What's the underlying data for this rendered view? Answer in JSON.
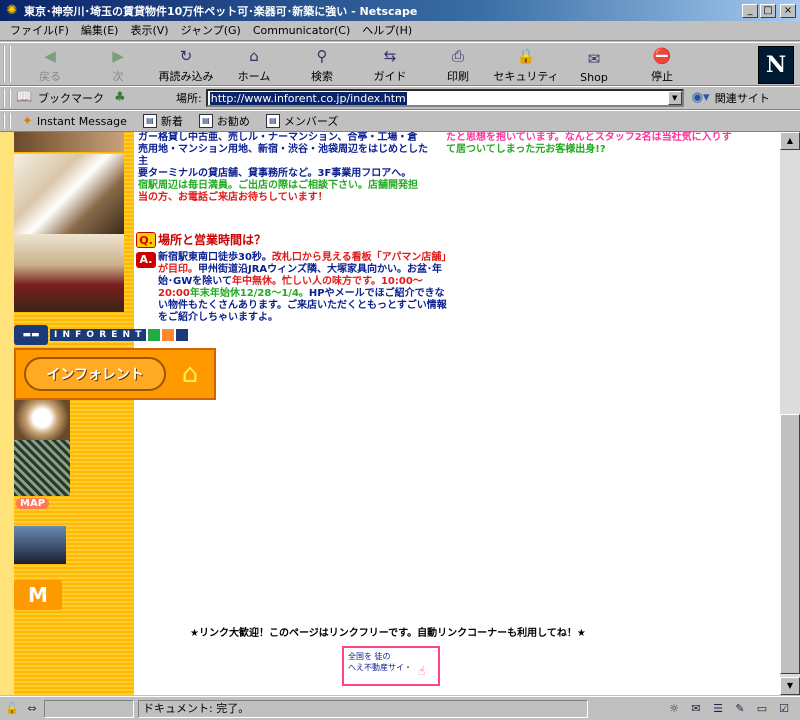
{
  "window": {
    "title": "東京･神奈川･埼玉の賃貸物件10万件ペット可･楽器可･新築に強い - Netscape",
    "controls": {
      "minimize": "_",
      "maximize": "□",
      "close": "×"
    }
  },
  "menu": [
    "ファイル(F)",
    "編集(E)",
    "表示(V)",
    "ジャンプ(G)",
    "Communicator(C)",
    "ヘルプ(H)"
  ],
  "nav_toolbar": {
    "buttons": [
      {
        "label": "戻る",
        "icon": "back-arrow-icon",
        "glyph": "◀",
        "enabled": false
      },
      {
        "label": "次",
        "icon": "forward-arrow-icon",
        "glyph": "▶",
        "enabled": false
      },
      {
        "label": "再読み込み",
        "icon": "reload-icon",
        "glyph": "↻",
        "enabled": true
      },
      {
        "label": "ホーム",
        "icon": "home-icon",
        "glyph": "⌂",
        "enabled": true
      },
      {
        "label": "検索",
        "icon": "search-icon",
        "glyph": "⚲",
        "enabled": true
      },
      {
        "label": "ガイド",
        "icon": "guide-icon",
        "glyph": "⇆",
        "enabled": true
      },
      {
        "label": "印刷",
        "icon": "print-icon",
        "glyph": "⎙",
        "enabled": true
      },
      {
        "label": "セキュリティ",
        "icon": "lock-icon",
        "glyph": "🔒",
        "enabled": true
      },
      {
        "label": "Shop",
        "icon": "shop-icon",
        "glyph": "✉",
        "enabled": true
      },
      {
        "label": "停止",
        "icon": "stop-icon",
        "glyph": "⛔",
        "enabled": true
      }
    ],
    "logo_letter": "N"
  },
  "location_bar": {
    "bookmark_label": "ブックマーク",
    "location_label": "場所:",
    "url": "http://www.inforent.co.jp/index.htm",
    "related_label": "関連サイト"
  },
  "personal_toolbar": [
    {
      "label": "Instant Message",
      "icon": "instant-message-icon"
    },
    {
      "label": "新着",
      "icon": "bookmark-page-icon"
    },
    {
      "label": "お勧め",
      "icon": "bookmark-page-icon"
    },
    {
      "label": "メンバーズ",
      "icon": "bookmark-page-icon"
    }
  ],
  "page": {
    "intro_lines": [
      "ガー格貸し中古亜、売しル・ナーマンション、合亭・工場・倉",
      "売用地・マンション用地、新宿・渋谷・池袋周辺をはじめとした主",
      "要ターミナルの貸店舗、貸事務所など。3F事業用フロアへ。",
      "宿駅周辺は毎日満員。ご出店の際はご相談下さい。店舗開発担",
      "当の方、お電話ご来店お待ちしています！"
    ],
    "right_snippet": [
      "たと思想を抱いています。なんとスタッフ2名は当社気に入りす",
      "て居ついてしまった元お客様出身!?"
    ],
    "q_badge": "Q.",
    "question": "場所と営業時間は？",
    "a_badge": "A.",
    "answer_parts": [
      "新宿駅東南口徒歩30秒。",
      "改札口から見える看板「アパマン店舗」が目印。",
      "甲州街道沿JRAウィンズ隣、大塚家具向かい。お盆･年始･GWを除いて",
      "年中無休。忙しい人の味方です。10:00～20:00",
      "年末年始休12/28～1/4。",
      "HPやメールでほご紹介できない物件もたくさんあります。ご来店いただくともっとすごい情報をご紹介しちゃいますよ。"
    ],
    "train_logo_text": "I N F O R E N T",
    "brand_name": "インフォレント",
    "map_label": "MAP",
    "badge_glyph": "M",
    "link_notice": "★リンク大歓迎！このページはリンクフリーです。自動リンクコーナーも利用してね！★",
    "link_banner_lines": [
      "全国を 徒の",
      "へえ不動産サイ・"
    ]
  },
  "status": {
    "text": "ドキュメント: 完了。"
  },
  "colors": {
    "accent_blue": "#0a246a",
    "sidebar_yellow": "#ffcc33",
    "text_red": "#e01a1a",
    "text_green": "#22aa22",
    "text_navy": "#0a1f8f"
  }
}
